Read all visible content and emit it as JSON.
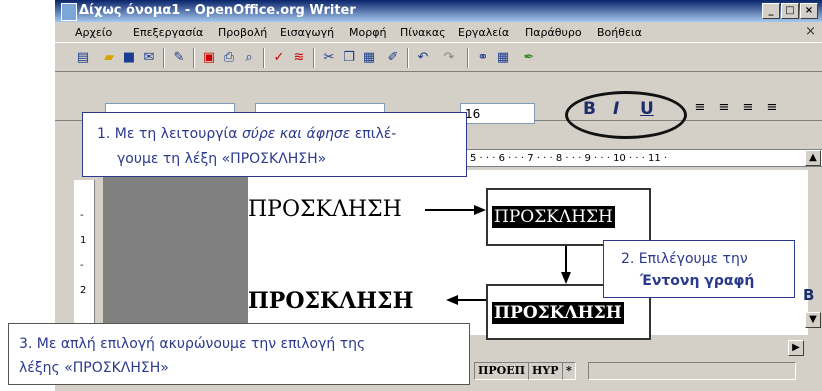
{
  "window": {
    "title": "Δίχως όνομα1 - OpenOffice.org Writer",
    "min": "_",
    "max": "□",
    "close": "×"
  },
  "menu": [
    "Αρχείο",
    "Επεξεργασία",
    "Προβολή",
    "Εισαγωγή",
    "Μορφή",
    "Πίνακας",
    "Εργαλεία",
    "Παράθυρο",
    "Βοήθεια"
  ],
  "menu_close": "×",
  "format": {
    "font_size": "16",
    "bold": "B",
    "italic": "I",
    "underline": "U"
  },
  "ruler": "5 · · · 6 · · · 7 · · · 8 · · · 9 · · · 10 · · · 11 ·",
  "vruler": [
    "-",
    "1",
    "-",
    "2"
  ],
  "document": {
    "word_left_top": "ΠΡΟΣΚΛΗΣΗ",
    "word_left_bottom": "ΠΡΟΣΚΛΗΣΗ",
    "word_sel_top": "ΠΡΟΣΚΛΗΣΗ",
    "word_sel_bottom": "ΠΡΟΣΚΛΗΣΗ"
  },
  "callouts": {
    "c1_prefix": "1. Με τη λειτουργία ",
    "c1_em": "σύρε και άφησε",
    "c1_suffix": " επιλέ-",
    "c1_line2": "γουμε τη λέξη «ΠΡΟΣΚΛΗΣΗ»",
    "c2_line1": "2. Επιλέγουμε την",
    "c2_line2": "Έντονη γραφή",
    "c3_line1": "3. Με απλή επιλογή ακυρώνουμε την επιλογή της",
    "c3_line2": "λέξης «ΠΡΟΣΚΛΗΣΗ»"
  },
  "status": {
    "cell1": "ΠΡΟΕΠ",
    "cell2": "HYP",
    "cell3": "*"
  },
  "side_bold": "B"
}
